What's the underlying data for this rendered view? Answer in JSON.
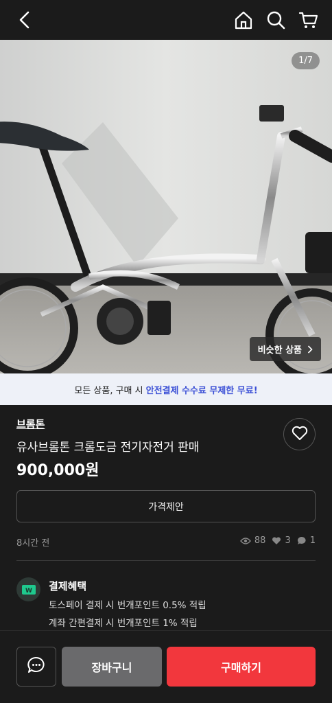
{
  "header": {
    "icons": [
      "back-arrow-icon",
      "home-icon",
      "search-icon",
      "cart-icon"
    ]
  },
  "photo": {
    "counter": "1/7",
    "similar_label": "비슷한 상품"
  },
  "promo": {
    "prefix": "모든 상품, 구매 시",
    "highlight": "안전결제 수수료 무제한 무료!",
    "highlight_color": "#3a4fd6"
  },
  "product": {
    "brand": "브롬톤",
    "title": "유사브롬톤 크롬도금 전기자전거 판매",
    "price": "900,000원",
    "offer_label": "가격제안",
    "posted": "8시간 전",
    "views": "88",
    "likes": "3",
    "chats": "1"
  },
  "benefit": {
    "title": "결제혜택",
    "line1": "토스페이 결제 시 번개포인트 0.5% 적립",
    "line2": "계좌 간편결제 시 번개포인트 1% 적립",
    "logo_text": "W"
  },
  "bottom": {
    "cart_label": "장바구니",
    "buy_label": "구매하기",
    "buy_color": "#f2373d"
  }
}
